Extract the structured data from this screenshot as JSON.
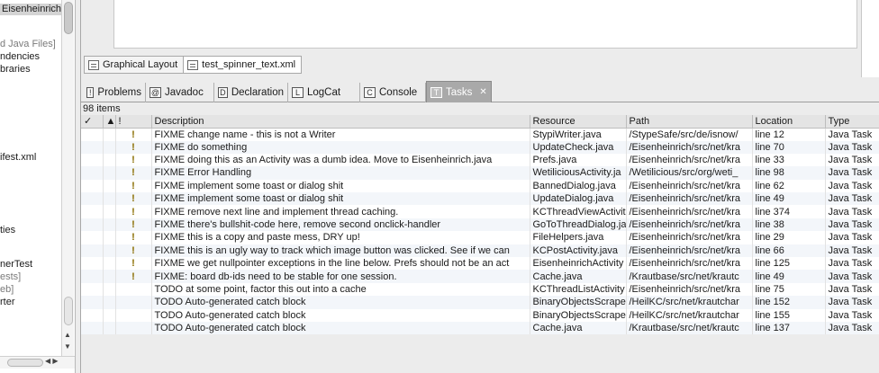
{
  "left_tree": [
    {
      "text": "Eisenheinrich",
      "style": "sel"
    },
    {
      "text": "d Java Files]",
      "style": "gray"
    },
    {
      "text": "ndencies",
      "style": ""
    },
    {
      "text": "braries",
      "style": ""
    },
    {
      "text": "ifest.xml",
      "style": ""
    },
    {
      "text": "ties",
      "style": ""
    },
    {
      "text": "nerTest",
      "style": ""
    },
    {
      "text": "ests]",
      "style": "gray"
    },
    {
      "text": "eb]",
      "style": "gray"
    },
    {
      "text": "rter",
      "style": ""
    }
  ],
  "editor_tabs": {
    "graphical_layout": "Graphical Layout",
    "file": "test_spinner_text.xml"
  },
  "view_tabs": [
    {
      "label": "Problems",
      "icon": "problems-icon",
      "glyph": "!"
    },
    {
      "label": "Javadoc",
      "icon": "javadoc-icon",
      "glyph": "@"
    },
    {
      "label": "Declaration",
      "icon": "declaration-icon",
      "glyph": "D"
    },
    {
      "label": "LogCat",
      "icon": "logcat-icon",
      "glyph": "L"
    },
    {
      "label": "Console",
      "icon": "console-icon",
      "glyph": "C"
    },
    {
      "label": "Tasks",
      "icon": "tasks-icon",
      "glyph": "T",
      "active": true
    }
  ],
  "tasks": {
    "count_label": "98 items",
    "columns": {
      "done": "✓",
      "sort": "▲",
      "priority": "!",
      "description": "Description",
      "resource": "Resource",
      "path": "Path",
      "location": "Location",
      "type": "Type"
    },
    "rows": [
      {
        "p": "!",
        "d": "FIXME change name - this is not a Writer",
        "r": "StypiWriter.java",
        "path": "/StypeSafe/src/de/isnow/",
        "loc": "line 12",
        "t": "Java Task"
      },
      {
        "p": "!",
        "d": "FIXME do something",
        "r": "UpdateCheck.java",
        "path": "/Eisenheinrich/src/net/kra",
        "loc": "line 70",
        "t": "Java Task"
      },
      {
        "p": "!",
        "d": "FIXME doing this as an Activity was a dumb idea. Move to Eisenheinrich.java",
        "r": "Prefs.java",
        "path": "/Eisenheinrich/src/net/kra",
        "loc": "line 33",
        "t": "Java Task"
      },
      {
        "p": "!",
        "d": "FIXME Error Handling",
        "r": "WetiliciousActivity.ja",
        "path": "/Wetilicious/src/org/weti_",
        "loc": "line 98",
        "t": "Java Task"
      },
      {
        "p": "!",
        "d": "FIXME implement some toast or dialog shit",
        "r": "BannedDialog.java",
        "path": "/Eisenheinrich/src/net/kra",
        "loc": "line 62",
        "t": "Java Task"
      },
      {
        "p": "!",
        "d": "FIXME implement some toast or dialog shit",
        "r": "UpdateDialog.java",
        "path": "/Eisenheinrich/src/net/kra",
        "loc": "line 49",
        "t": "Java Task"
      },
      {
        "p": "!",
        "d": "FIXME remove next line and implement thread caching.",
        "r": "KCThreadViewActivit",
        "path": "/Eisenheinrich/src/net/kra",
        "loc": "line 374",
        "t": "Java Task"
      },
      {
        "p": "!",
        "d": "FIXME there's bullshit-code here, remove second onclick-handler",
        "r": "GoToThreadDialog.ja",
        "path": "/Eisenheinrich/src/net/kra",
        "loc": "line 38",
        "t": "Java Task"
      },
      {
        "p": "!",
        "d": "FIXME this is a copy and paste mess, DRY up!",
        "r": "FileHelpers.java",
        "path": "/Eisenheinrich/src/net/kra",
        "loc": "line 29",
        "t": "Java Task"
      },
      {
        "p": "!",
        "d": "FIXME this is an ugly way to track which image button was clicked. See if we can",
        "r": "KCPostActivity.java",
        "path": "/Eisenheinrich/src/net/kra",
        "loc": "line 66",
        "t": "Java Task"
      },
      {
        "p": "!",
        "d": "FIXME we get nullpointer exceptions in the line below. Prefs should not be an act",
        "r": "EisenheinrichActivity",
        "path": "/Eisenheinrich/src/net/kra",
        "loc": "line 125",
        "t": "Java Task"
      },
      {
        "p": "!",
        "d": "FIXME: board db-ids need to be stable for one session.",
        "r": "Cache.java",
        "path": "/Krautbase/src/net/krautc",
        "loc": "line 49",
        "t": "Java Task"
      },
      {
        "p": "",
        "d": "TODO at some point, factor this out into a cache",
        "r": "KCThreadListActivity",
        "path": "/Eisenheinrich/src/net/kra",
        "loc": "line 75",
        "t": "Java Task"
      },
      {
        "p": "",
        "d": "TODO Auto-generated catch block",
        "r": "BinaryObjectsScraper",
        "path": "/HeilKC/src/net/krautchar",
        "loc": "line 152",
        "t": "Java Task"
      },
      {
        "p": "",
        "d": "TODO Auto-generated catch block",
        "r": "BinaryObjectsScraper",
        "path": "/HeilKC/src/net/krautchar",
        "loc": "line 155",
        "t": "Java Task"
      },
      {
        "p": "",
        "d": "TODO Auto-generated catch block",
        "r": "Cache.java",
        "path": "/Krautbase/src/net/krautc",
        "loc": "line 137",
        "t": "Java Task"
      }
    ]
  }
}
